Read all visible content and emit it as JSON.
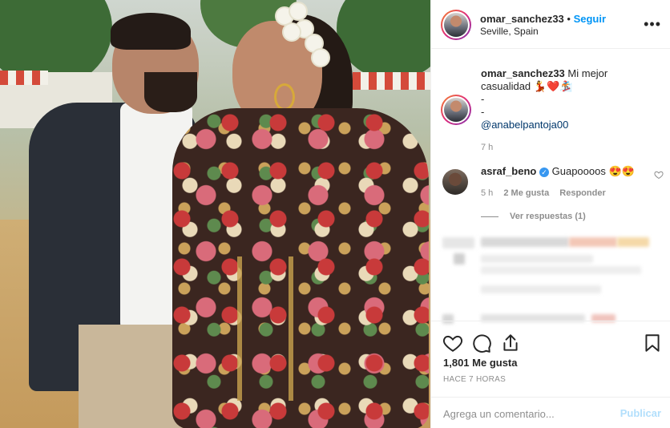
{
  "post": {
    "username": "omar_sanchez33",
    "separator": "•",
    "follow_label": "Seguir",
    "location": "Seville, Spain",
    "more_icon": "more-horizontal-icon"
  },
  "caption": {
    "username": "omar_sanchez33",
    "text": "Mi mejor casualidad",
    "emoji": "💃❤️🏂",
    "line2": "-",
    "line3": "-",
    "mention": "@anabelpantoja00",
    "time": "7 h"
  },
  "comment": {
    "username": "asraf_beno",
    "verified_icon": "verified-badge-icon",
    "text": "Guapoooos",
    "emoji": "😍😍",
    "time": "5 h",
    "likes": "2 Me gusta",
    "reply_label": "Responder",
    "view_replies": "Ver respuestas (1)"
  },
  "actions": {
    "like_icon": "heart-icon",
    "comment_icon": "comment-icon",
    "share_icon": "share-icon",
    "save_icon": "bookmark-icon",
    "likes_count": "1,801 Me gusta",
    "posted": "HACE 7 HORAS"
  },
  "add_comment": {
    "placeholder": "Agrega un comentario...",
    "publish_label": "Publicar"
  },
  "colors": {
    "link_blue": "#0095f6",
    "mention_blue": "#00376b",
    "muted": "#8e8e8e",
    "publish_disabled": "#b2dffc"
  }
}
